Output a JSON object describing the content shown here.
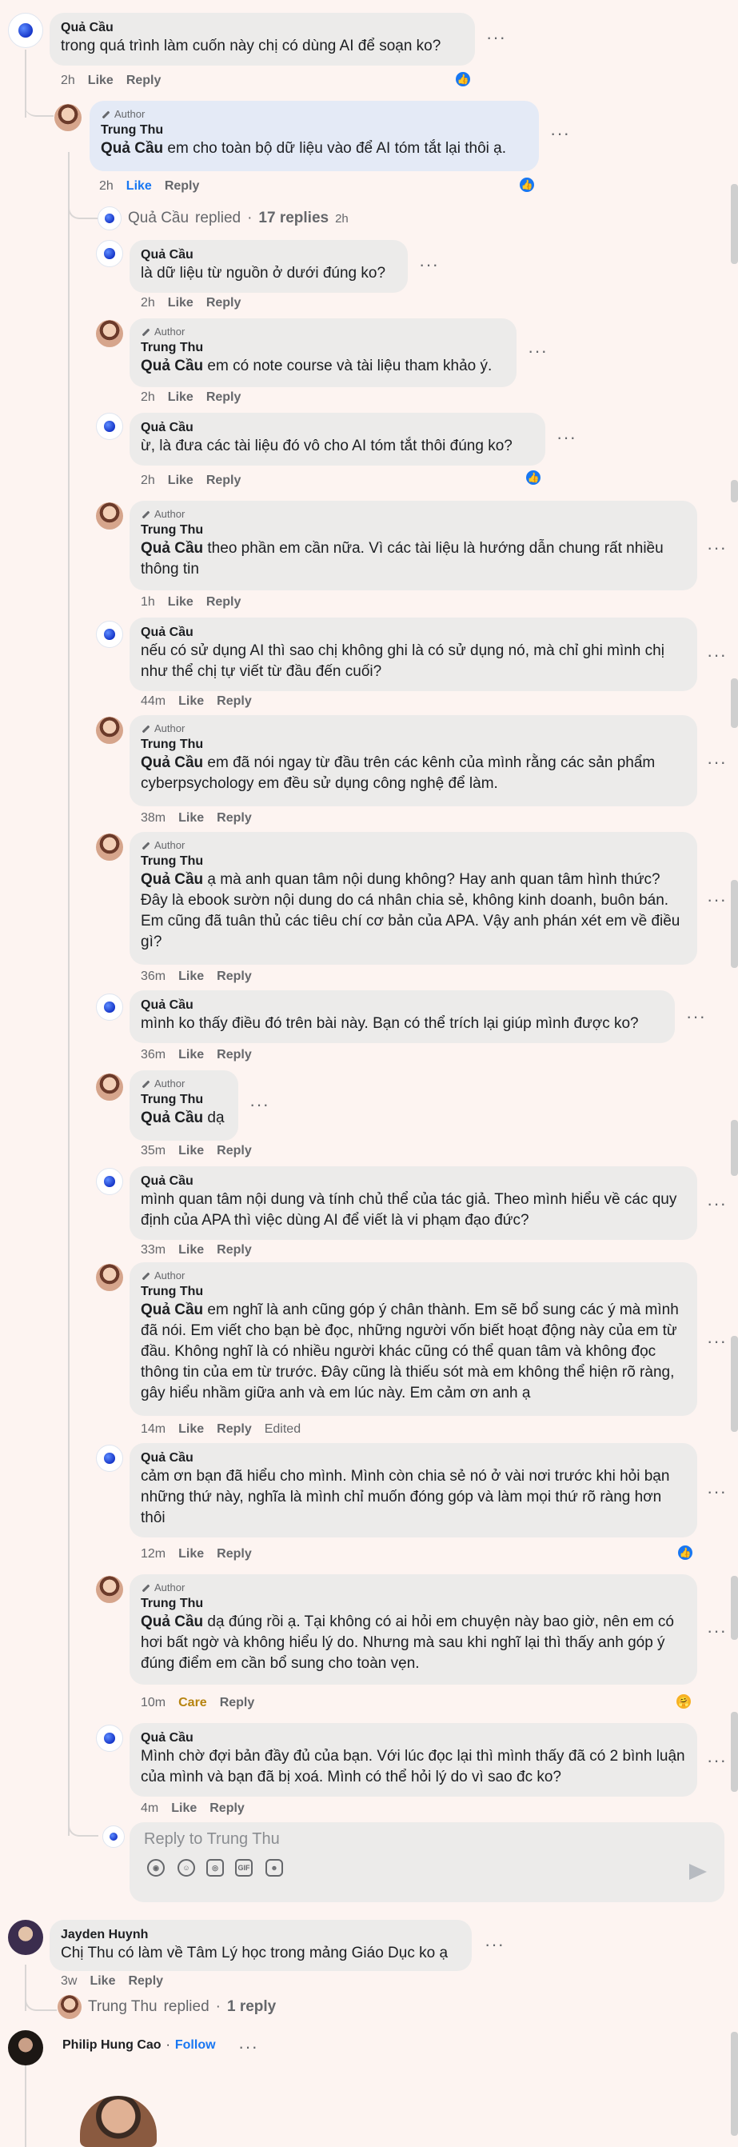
{
  "comments": [
    {
      "name": "Quả Cầu",
      "author": false,
      "text": "trong quá trình làm cuốn này chị có dùng AI để soạn ko?",
      "time": "2h",
      "like": "Like",
      "reply": "Reply",
      "reaction": "like"
    },
    {
      "name": "Trung Thu",
      "author": true,
      "author_label": "Author",
      "mention": "Quả Cầu",
      "text": " em cho toàn bộ dữ liệu vào để AI tóm tắt lại thôi ạ.",
      "time": "2h",
      "like": "Like",
      "reply": "Reply",
      "reaction": "like"
    }
  ],
  "thread_replied": {
    "name": "Quả Cầu",
    "label": "replied",
    "count": "17 replies",
    "time": "2h"
  },
  "replies": [
    {
      "name": "Quả Cầu",
      "author": false,
      "text": "là dữ liệu từ nguồn ở dưới đúng ko?",
      "time": "2h",
      "like": "Like",
      "reply": "Reply"
    },
    {
      "name": "Trung Thu",
      "author": true,
      "author_label": "Author",
      "mention": "Quả Cầu",
      "text": " em có note course và tài liệu tham khảo ý.",
      "time": "2h",
      "like": "Like",
      "reply": "Reply"
    },
    {
      "name": "Quả Cầu",
      "author": false,
      "text": "ừ, là đưa các tài liệu đó vô cho AI tóm tắt thôi đúng ko?",
      "time": "2h",
      "like": "Like",
      "reply": "Reply",
      "reaction": "like"
    },
    {
      "name": "Trung Thu",
      "author": true,
      "author_label": "Author",
      "mention": "Quả Cầu",
      "text": " theo phần em cần nữa. Vì các tài liệu là hướng dẫn chung rất nhiều thông tin",
      "time": "1h",
      "like": "Like",
      "reply": "Reply"
    },
    {
      "name": "Quả Cầu",
      "author": false,
      "text": "nếu có sử dụng AI thì sao chị không ghi là có sử dụng nó, mà chỉ ghi mình chị như thể chị tự viết từ đầu đến cuối?",
      "time": "44m",
      "like": "Like",
      "reply": "Reply"
    },
    {
      "name": "Trung Thu",
      "author": true,
      "author_label": "Author",
      "mention": "Quả Cầu",
      "text": " em đã nói ngay từ đầu trên các kênh của mình rằng các sản phẩm cyberpsychology em đều sử dụng công nghệ để làm.",
      "time": "38m",
      "like": "Like",
      "reply": "Reply"
    },
    {
      "name": "Trung Thu",
      "author": true,
      "author_label": "Author",
      "mention": "Quả Cầu",
      "text": " ạ mà anh quan tâm nội dung không? Hay anh quan tâm hình thức? Đây là ebook sườn nội dung do cá nhân chia sẻ, không kinh doanh, buôn bán. Em cũng đã tuân thủ các tiêu chí cơ bản của APA. Vậy anh phán xét em về điều gì?",
      "time": "36m",
      "like": "Like",
      "reply": "Reply"
    },
    {
      "name": "Quả Cầu",
      "author": false,
      "text": "mình ko thấy điều đó trên bài này. Bạn có thể trích lại giúp mình được ko?",
      "time": "36m",
      "like": "Like",
      "reply": "Reply"
    },
    {
      "name": "Trung Thu",
      "author": true,
      "author_label": "Author",
      "mention": "Quả Cầu",
      "text": " dạ",
      "time": "35m",
      "like": "Like",
      "reply": "Reply"
    },
    {
      "name": "Quả Cầu",
      "author": false,
      "text": "mình quan tâm nội dung và tính chủ thể của tác giả. Theo mình hiểu về các quy định của APA thì việc dùng AI để viết là vi phạm đạo đức?",
      "time": "33m",
      "like": "Like",
      "reply": "Reply"
    },
    {
      "name": "Trung Thu",
      "author": true,
      "author_label": "Author",
      "mention": "Quả Cầu",
      "text": " em nghĩ là anh cũng góp ý chân thành. Em sẽ bổ sung các ý mà mình đã nói. Em viết cho bạn bè đọc, những người vốn biết hoạt động này của em từ đầu. Không nghĩ là có nhiều người khác cũng có thể quan tâm và không đọc thông tin của em từ trước. Đây cũng là thiếu sót mà em không thể hiện rõ ràng, gây hiểu nhầm giữa anh và em lúc này. Em cảm ơn anh ạ",
      "time": "14m",
      "like": "Like",
      "reply": "Reply",
      "edited": "Edited"
    },
    {
      "name": "Quả Cầu",
      "author": false,
      "text": "cảm ơn bạn đã hiểu cho mình. Mình còn chia sẻ nó ở vài nơi trước khi hỏi bạn những thứ này, nghĩa là mình chỉ muốn đóng góp và làm mọi thứ rõ ràng hơn thôi",
      "time": "12m",
      "like": "Like",
      "reply": "Reply",
      "reaction": "like"
    },
    {
      "name": "Trung Thu",
      "author": true,
      "author_label": "Author",
      "mention": "Quả Cầu",
      "text": " dạ đúng rồi ạ. Tại không có ai hỏi em chuyện này bao giờ, nên em có hơi bất ngờ và không hiểu lý do. Nhưng mà sau khi nghĩ lại thì thấy anh góp ý đúng điểm em cần bổ sung cho toàn vẹn.",
      "time": "10m",
      "like": "Care",
      "reply": "Reply",
      "reaction": "care"
    },
    {
      "name": "Quả Cầu",
      "author": false,
      "text": "Mình chờ đợi bản đầy đủ của bạn. Với lúc đọc lại thì mình thấy đã có 2 bình luận của mình và bạn đã bị xoá. Mình có thể hỏi lý do vì sao đc ko?",
      "time": "4m",
      "like": "Like",
      "reply": "Reply"
    }
  ],
  "composer": {
    "placeholder": "Reply to Trung Thu",
    "tools": [
      "avatar-sticker-icon",
      "emoji-icon",
      "camera-icon",
      "gif-icon",
      "sticker-icon"
    ],
    "gif_label": "GIF"
  },
  "jayden": {
    "name": "Jayden Huynh",
    "text": "Chị Thu có làm về Tâm Lý học trong mảng Giáo Dục ko ạ",
    "time": "3w",
    "like": "Like",
    "reply": "Reply"
  },
  "jayden_replied": {
    "name": "Trung Thu",
    "label": "replied",
    "count": "1 reply"
  },
  "philip": {
    "name": "Philip Hung Cao",
    "sep": "·",
    "follow": "Follow"
  },
  "icons": {
    "like": "👍",
    "care": "🤗",
    "more": "···"
  }
}
